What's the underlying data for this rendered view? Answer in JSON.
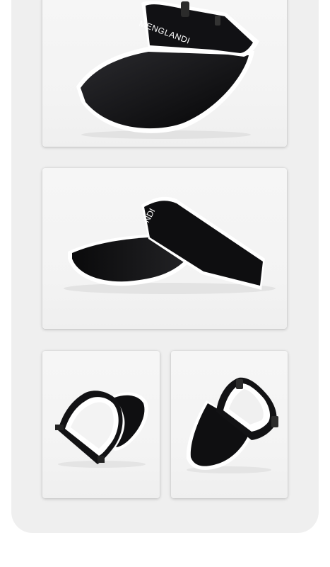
{
  "product": {
    "brand_text": "MENGLANDI",
    "side_brand_text": "NDI"
  },
  "gallery": {
    "views": [
      {
        "view": "front-angle",
        "icon": "visor-cap-image"
      },
      {
        "view": "side",
        "icon": "visor-cap-image"
      },
      {
        "view": "top-inside",
        "icon": "visor-cap-image"
      },
      {
        "view": "back-strap",
        "icon": "visor-cap-image"
      }
    ]
  },
  "colors": {
    "cap": "#0d0d0f",
    "trim": "#ffffff",
    "panel": "#efefef",
    "card": "#f5f5f5"
  }
}
